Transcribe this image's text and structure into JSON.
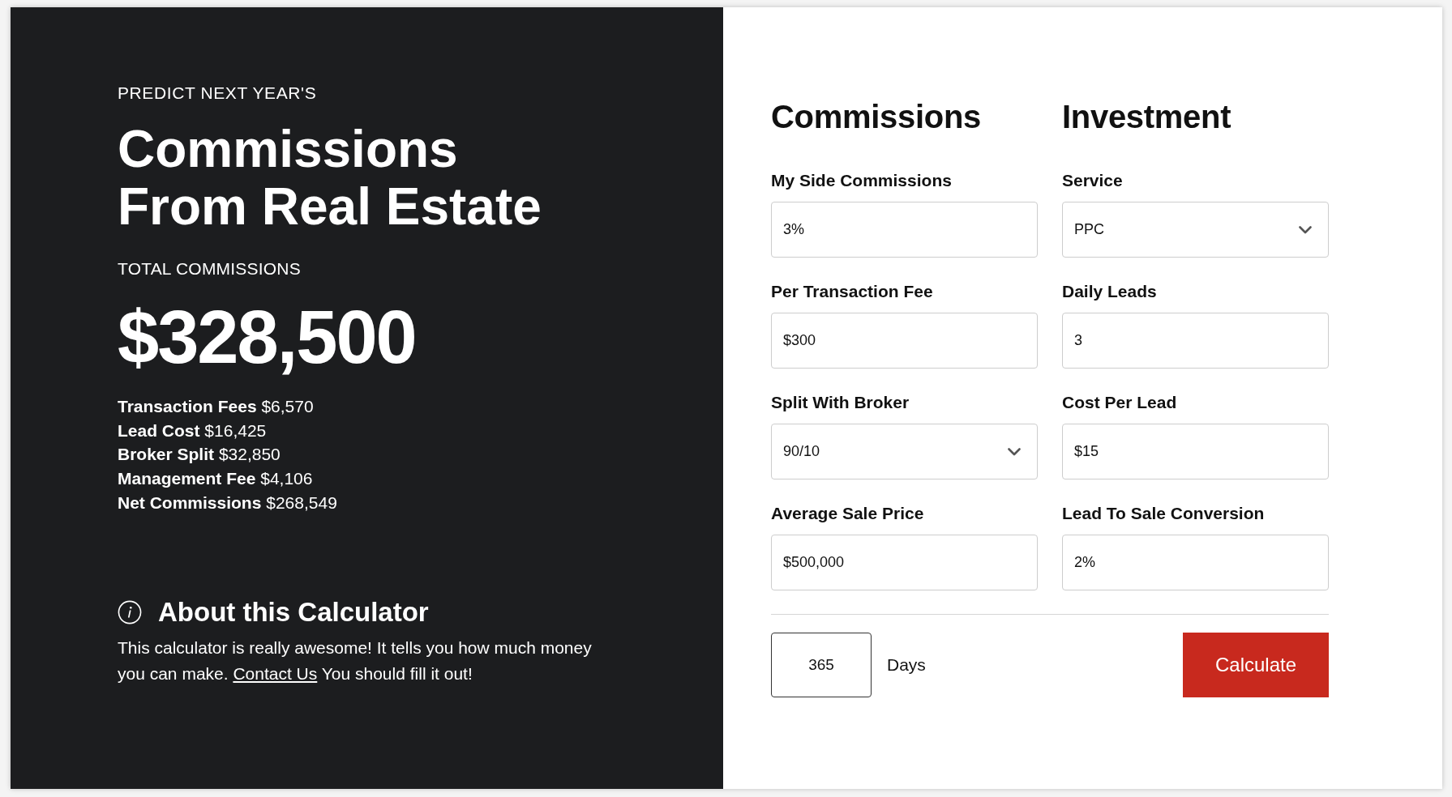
{
  "summary": {
    "eyebrow": "PREDICT NEXT YEAR'S",
    "title": "Commissions From Real Estate",
    "total_label": "TOTAL COMMISSIONS",
    "total_value": "$328,500",
    "breakdown": [
      {
        "label": "Transaction Fees",
        "value": "$6,570"
      },
      {
        "label": "Lead Cost",
        "value": "$16,425"
      },
      {
        "label": "Broker Split",
        "value": "$32,850"
      },
      {
        "label": "Management Fee",
        "value": "$4,106"
      },
      {
        "label": "Net Commissions",
        "value": "$268,549"
      }
    ]
  },
  "about": {
    "heading": "About this Calculator",
    "text": "This calculator is really awesome! It tells you how much money you can make.",
    "link": "Contact Us",
    "text_after": "You should fill it out!"
  },
  "form": {
    "columns": [
      {
        "heading": "Commissions",
        "fields": [
          {
            "label": "My Side Commissions",
            "kind": "text",
            "value": "3%"
          },
          {
            "label": "Per Transaction Fee",
            "kind": "text",
            "value": "$300"
          },
          {
            "label": "Split With Broker",
            "kind": "select",
            "value": "90/10"
          },
          {
            "label": "Average Sale Price",
            "kind": "text",
            "value": "$500,000"
          }
        ]
      },
      {
        "heading": "Investment",
        "fields": [
          {
            "label": "Service",
            "kind": "select",
            "value": "PPC"
          },
          {
            "label": "Daily Leads",
            "kind": "text",
            "value": "3"
          },
          {
            "label": "Cost Per Lead",
            "kind": "text",
            "value": "$15"
          },
          {
            "label": "Lead To Sale Conversion",
            "kind": "text",
            "value": "2%"
          }
        ]
      }
    ],
    "period": {
      "value": "365",
      "unit": "Days"
    },
    "submit": "Calculate"
  }
}
